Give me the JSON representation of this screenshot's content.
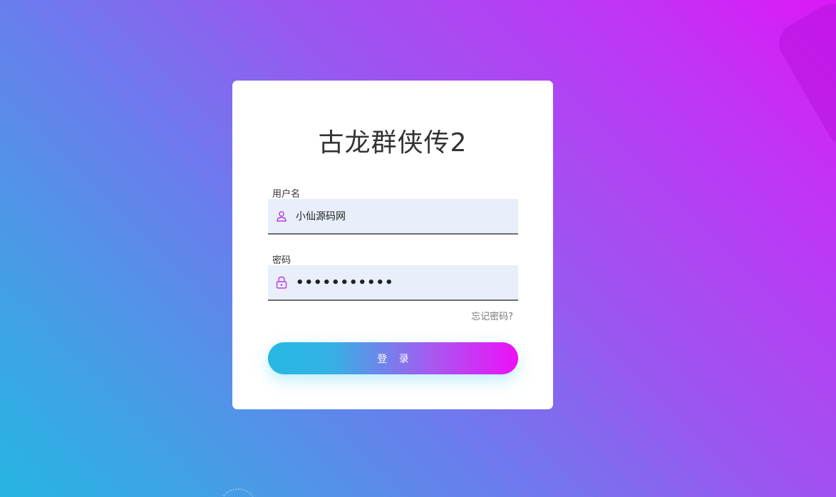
{
  "login": {
    "title": "古龙群侠传2",
    "username_label": "用户名",
    "username_value": "小仙源码网",
    "password_label": "密码",
    "password_value": "•••••••••••",
    "forgot_label": "忘记密码?",
    "submit_label": "登 录"
  },
  "icons": {
    "username": "user-icon",
    "password": "lock-icon"
  },
  "colors": {
    "gradient_start": "#25b6e3",
    "gradient_end": "#dc18f6",
    "icon_accent": "#b53be6",
    "field_background": "#e8effa"
  }
}
